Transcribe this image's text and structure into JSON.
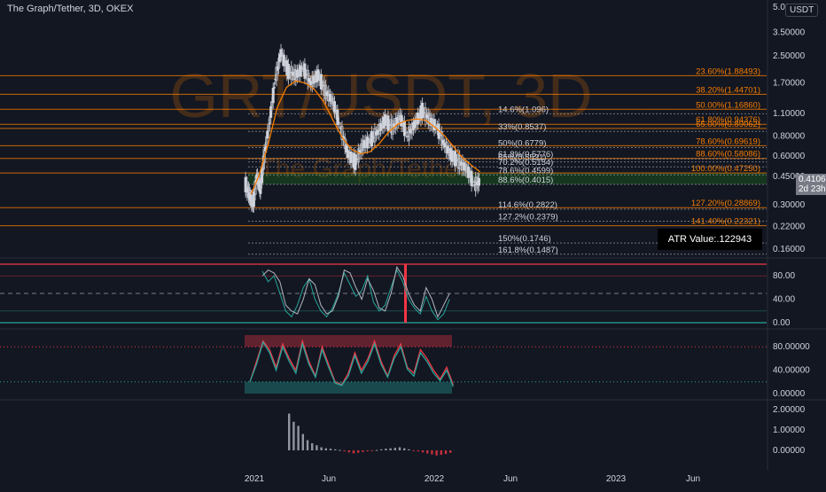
{
  "header": {
    "title": "The Graph/Tether, 3D, OKEX",
    "currency_badge": "USDT"
  },
  "watermark": {
    "symbol": "GRT/USDT, 3D",
    "name": "The Graph/Tether"
  },
  "atr_label": "ATR Value:.122943",
  "last_price": {
    "value": "0.41060",
    "countdown": "2d 23h"
  },
  "chart_data": [
    {
      "type": "candlestick",
      "ylim": [
        0.16,
        5.0
      ],
      "log_scale": true,
      "grid": false,
      "y_ticks": [
        "5.00",
        "3.50000",
        "2.50000",
        "1.70000",
        "1.10000",
        "0.80000",
        "0.60000",
        "0.45000",
        "0.30000",
        "0.22000",
        "0.16000"
      ],
      "x_ticks": [
        "2021",
        "Jun",
        "2022",
        "Jun",
        "2023",
        "Jun"
      ],
      "moving_average": {
        "color": "#f57c00",
        "x": [
          0.6,
          1.0,
          1.5,
          2.0,
          2.5,
          3.0,
          3.5,
          4.0,
          4.5,
          5.0,
          5.5,
          6.0,
          6.5,
          7.0,
          7.5,
          8.0,
          8.5,
          9.0,
          9.5,
          10.0,
          10.5,
          11.0,
          11.5,
          12.0,
          12.5,
          12.9
        ],
        "y": [
          0.35,
          0.45,
          0.7,
          1.2,
          1.6,
          1.75,
          1.7,
          1.55,
          1.3,
          1.0,
          0.78,
          0.66,
          0.62,
          0.64,
          0.72,
          0.85,
          0.95,
          1.0,
          1.02,
          1.0,
          0.9,
          0.8,
          0.68,
          0.58,
          0.52,
          0.48
        ]
      },
      "price_path": {
        "x": [
          0.3,
          0.5,
          0.7,
          0.9,
          1.1,
          1.3,
          1.6,
          1.9,
          2.2,
          2.6,
          3.0,
          3.4,
          3.8,
          4.2,
          4.6,
          5.0,
          5.4,
          5.8,
          6.2,
          6.6,
          7.0,
          7.4,
          7.8,
          8.2,
          8.6,
          9.0,
          9.4,
          9.8,
          10.2,
          10.6,
          11.0,
          11.4,
          11.8,
          12.2,
          12.6,
          12.9
        ],
        "y": [
          0.4,
          0.35,
          0.3,
          0.45,
          0.38,
          0.6,
          1.0,
          1.8,
          2.6,
          2.0,
          1.9,
          2.1,
          1.7,
          1.9,
          1.5,
          1.3,
          0.9,
          0.62,
          0.55,
          0.7,
          0.75,
          0.85,
          1.0,
          0.9,
          1.05,
          0.8,
          0.95,
          1.15,
          1.0,
          0.9,
          0.7,
          0.6,
          0.55,
          0.5,
          0.4,
          0.42
        ]
      }
    },
    {
      "type": "line",
      "title": "",
      "ylim": [
        0,
        100
      ],
      "y_ticks": [
        "80.00",
        "40.00",
        "0.00"
      ],
      "series": [
        {
          "color": "#26a69a",
          "values": [
            88,
            70,
            80,
            50,
            20,
            10,
            30,
            60,
            75,
            40,
            20,
            10,
            25,
            50,
            85,
            65,
            45,
            55,
            80,
            35,
            20,
            30,
            60,
            90,
            70,
            40,
            25,
            15,
            45,
            20,
            5,
            15,
            40
          ]
        },
        {
          "color": "#b2b5be",
          "values": [
            80,
            90,
            85,
            70,
            30,
            20,
            15,
            40,
            75,
            65,
            30,
            15,
            20,
            45,
            90,
            85,
            60,
            40,
            75,
            55,
            25,
            20,
            50,
            95,
            80,
            50,
            30,
            20,
            60,
            40,
            10,
            30,
            50
          ]
        }
      ]
    },
    {
      "type": "line",
      "ylim": [
        0,
        100
      ],
      "y_ticks": [
        "80.00000",
        "40.00000",
        "0.00000"
      ],
      "series": [
        {
          "color": "#f23645",
          "values": [
            20,
            55,
            90,
            75,
            45,
            85,
            60,
            40,
            90,
            55,
            30,
            80,
            50,
            20,
            15,
            35,
            70,
            40,
            60,
            90,
            55,
            30,
            65,
            85,
            45,
            35,
            75,
            60,
            40,
            25,
            45,
            15
          ]
        },
        {
          "color": "#26a69a",
          "values": [
            20,
            50,
            88,
            70,
            40,
            80,
            55,
            35,
            85,
            50,
            28,
            75,
            45,
            18,
            14,
            30,
            65,
            35,
            55,
            85,
            50,
            28,
            60,
            80,
            42,
            30,
            70,
            55,
            35,
            22,
            40,
            12
          ]
        }
      ]
    },
    {
      "type": "bar",
      "ylim": [
        -0.3,
        2.0
      ],
      "y_ticks": [
        "2.00000",
        "1.00000",
        "0.00000"
      ],
      "values": [
        1.8,
        1.4,
        1.2,
        0.8,
        0.5,
        0.35,
        0.25,
        0.15,
        0.1,
        0.08,
        0.05,
        0.02,
        -0.05,
        -0.1,
        -0.15,
        -0.12,
        -0.08,
        -0.05,
        -0.02,
        0.02,
        0.05,
        0.08,
        0.1,
        0.12,
        0.15,
        0.1,
        0.05,
        -0.02,
        -0.05,
        -0.1,
        -0.15,
        -0.2,
        -0.25,
        -0.22,
        -0.18,
        -0.12
      ]
    }
  ],
  "fib_right": [
    {
      "label": "23.60%(1.88493)",
      "price": 1.88493,
      "color": "#f57c00"
    },
    {
      "label": "38.20%(1.44701)",
      "price": 1.44701,
      "color": "#f57c00"
    },
    {
      "label": "50.00%(1.16860)",
      "price": 1.1686,
      "color": "#f57c00"
    },
    {
      "label": "61.80%(0.94376)",
      "price": 0.94376,
      "color": "#f57c00"
    },
    {
      "label": "65.00%(0.89062)",
      "price": 0.89062,
      "color": "#f57c00"
    },
    {
      "label": "78.60%(0.69619)",
      "price": 0.69619,
      "color": "#f57c00"
    },
    {
      "label": "88.60%(0.58086)",
      "price": 0.58086,
      "color": "#f57c00"
    },
    {
      "label": "100.00%(0.47250)",
      "price": 0.4725,
      "color": "#f57c00"
    },
    {
      "label": "127.20%(0.28869)",
      "price": 0.28869,
      "color": "#f57c00"
    },
    {
      "label": "141.40%(0.22321)",
      "price": 0.22321,
      "color": "#f57c00"
    }
  ],
  "fib_mid": [
    {
      "label": "14.6%(1.096)",
      "price": 1.096
    },
    {
      "label": "33%(0.8537)",
      "price": 0.8537
    },
    {
      "label": "50%(0.6779)",
      "price": 0.6779
    },
    {
      "label": "61.8%(0.5776)",
      "price": 0.5776
    },
    {
      "label": "65%(0.5531)",
      "price": 0.5531
    },
    {
      "label": "70.2%(0.5154)",
      "price": 0.5154
    },
    {
      "label": "78.6%(0.4599)",
      "price": 0.4599
    },
    {
      "label": "88.6%(0.4015)",
      "price": 0.4015
    },
    {
      "label": "114.6%(0.2822)",
      "price": 0.2822
    },
    {
      "label": "127.2%(0.2379)",
      "price": 0.2379
    },
    {
      "label": "150%(0.1746)",
      "price": 0.1746
    },
    {
      "label": "161.8%(0.1487)",
      "price": 0.1487
    }
  ],
  "colors": {
    "background": "#131722",
    "up": "#d1d4dc",
    "fib_orange": "#f57c00",
    "zone_green": "#1b5e20",
    "indicator_red": "#f23645",
    "indicator_teal": "#26a69a",
    "axis_text": "#d1d4dc"
  }
}
